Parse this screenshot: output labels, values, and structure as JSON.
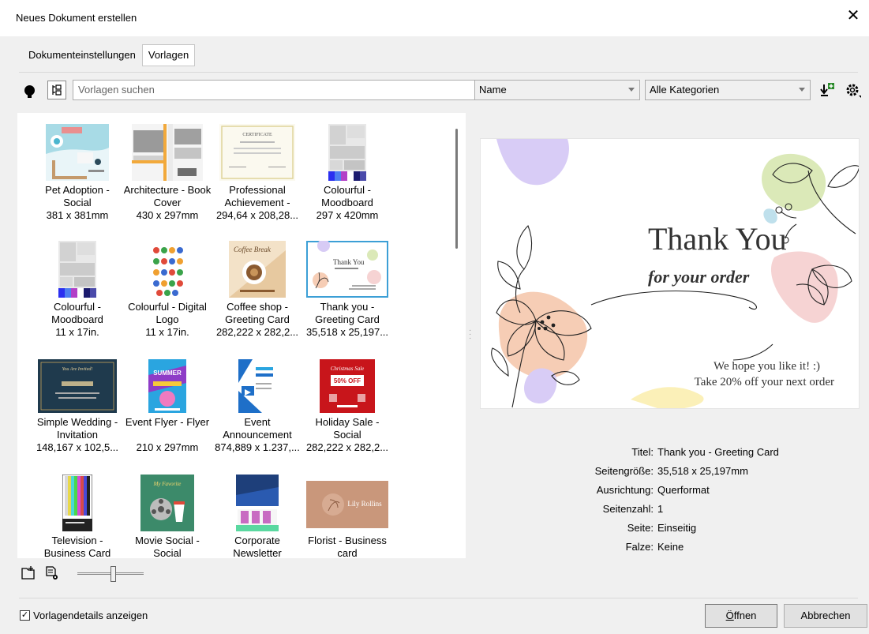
{
  "window": {
    "title": "Neues Dokument erstellen"
  },
  "tabs": [
    {
      "label": "Dokumenteinstellungen",
      "active": false
    },
    {
      "label": "Vorlagen",
      "active": true
    }
  ],
  "toolbar": {
    "search_placeholder": "Vorlagen suchen",
    "sort_select": "Name",
    "category_select": "Alle Kategorien"
  },
  "templates": [
    {
      "name": "Pet Adoption - Social",
      "size": "381 x 381mm"
    },
    {
      "name": "Architecture - Book Cover",
      "size": "430 x 297mm"
    },
    {
      "name": "Professional Achievement -",
      "size": "294,64 x 208,28..."
    },
    {
      "name": "Colourful - Moodboard",
      "size": "297 x 420mm"
    },
    {
      "name": "Colourful - Moodboard",
      "size": "11 x 17in."
    },
    {
      "name": "Colourful - Digital Logo",
      "size": "11 x 17in."
    },
    {
      "name": "Coffee shop - Greeting Card",
      "size": "282,222 x 282,2..."
    },
    {
      "name": "Thank you - Greeting Card",
      "size": "35,518 x 25,197...",
      "selected": true
    },
    {
      "name": "Simple Wedding - Invitation",
      "size": "148,167 x 102,5..."
    },
    {
      "name": "Event Flyer - Flyer",
      "size": "210 x 297mm"
    },
    {
      "name": "Event Announcement",
      "size": "874,889 x 1.237,..."
    },
    {
      "name": "Holiday Sale - Social",
      "size": "282,222 x 282,2..."
    },
    {
      "name": "Television - Business Card",
      "size": ""
    },
    {
      "name": "Movie Social - Social",
      "size": ""
    },
    {
      "name": "Corporate Newsletter",
      "size": ""
    },
    {
      "name": "Florist - Business card",
      "size": ""
    }
  ],
  "thumb_text": {
    "certificate": "CERTIFICATE",
    "thankyou": "Thank You",
    "coffee": "Coffee Break",
    "wedding": "You Are Invited!",
    "summer": "SUMMER",
    "sale": "Christmas Sale",
    "sale_off": "50% OFF",
    "movie": "My Favorite",
    "florist": "Lily Rollins"
  },
  "preview": {
    "heading": "Thank You",
    "subheading": "for your order",
    "line1": "We hope you like it! :)",
    "line2": "Take 20% off your next order"
  },
  "details": [
    {
      "key": "Titel:",
      "value": "Thank you - Greeting Card"
    },
    {
      "key": "Seitengröße:",
      "value": "35,518 x 25,197mm"
    },
    {
      "key": "Ausrichtung:",
      "value": "Querformat"
    },
    {
      "key": "Seitenzahl:",
      "value": "1"
    },
    {
      "key": "Seite:",
      "value": "Einseitig"
    },
    {
      "key": "Falze:",
      "value": "Keine"
    }
  ],
  "footer": {
    "show_details_label": "Vorlagendetails anzeigen",
    "show_details_checked": true,
    "open_button_prefix": "",
    "open_button_mnemonic": "Ö",
    "open_button_rest": "ffnen",
    "cancel_button": "Abbrechen",
    "zoom_level": 0.55
  },
  "colors": {
    "selection": "#3c9fd6",
    "accent": "#2a8a2a"
  }
}
